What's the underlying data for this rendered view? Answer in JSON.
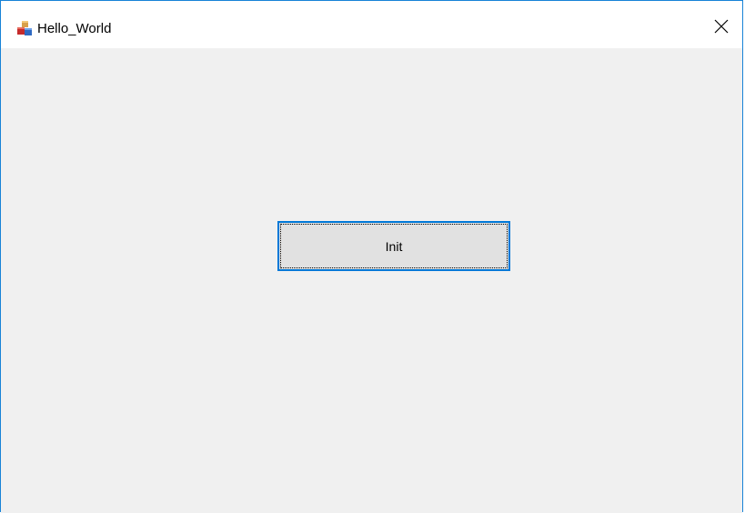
{
  "window": {
    "title": "Hello_World",
    "icon": "app-cubes-icon",
    "close_icon": "close-icon"
  },
  "main": {
    "init_button_label": "Init"
  },
  "colors": {
    "accent_border": "#0078d7",
    "window_border": "#1883d7",
    "client_background": "#f0f0f0",
    "button_face": "#e1e1e1",
    "titlebar_background": "#ffffff"
  }
}
